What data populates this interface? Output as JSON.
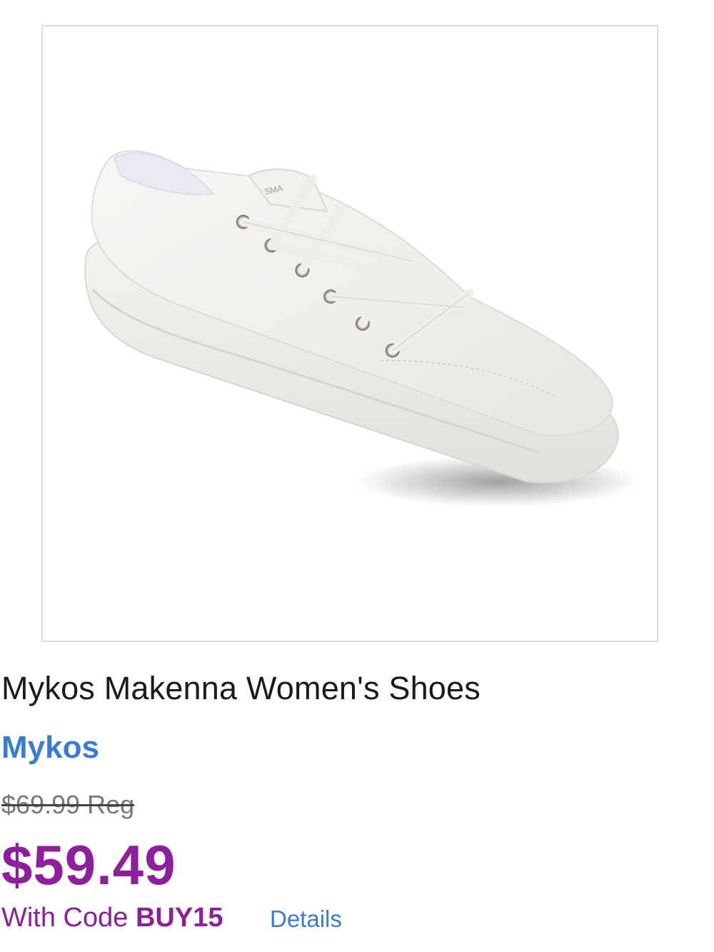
{
  "product": {
    "image_alt": "white lace-up sneaker",
    "title": "Mykos Makenna Women's Shoes",
    "brand": "Mykos",
    "shoe_tongue_label": "SMA"
  },
  "pricing": {
    "regular_price": "$69.99 Reg",
    "sale_price": "$59.49",
    "promo_prefix": "With Code ",
    "promo_code": "BUY15",
    "details_label": "Details"
  },
  "colors": {
    "sale": "#8e1f9c",
    "link": "#3a7bd5",
    "frame_border": "#dcdcdc"
  }
}
